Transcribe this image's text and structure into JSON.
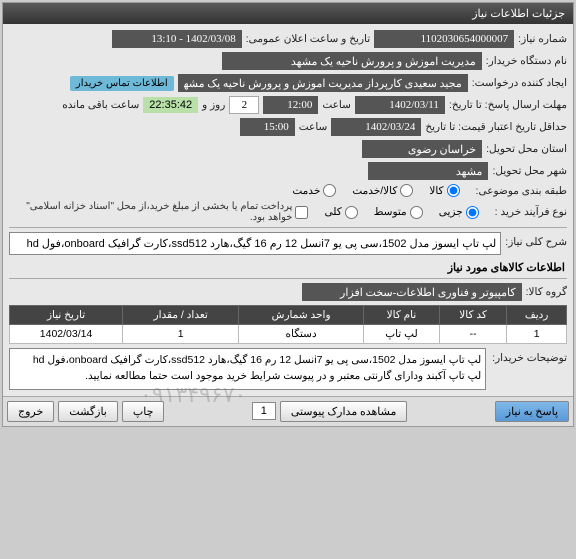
{
  "header": {
    "title": "جزئیات اطلاعات نیاز"
  },
  "form": {
    "need_number_label": "شماره نیاز:",
    "need_number": "1102030654000007",
    "announce_label": "تاریخ و ساعت اعلان عمومی:",
    "announce_value": "1402/03/08 - 13:10",
    "buyer_org_label": "نام دستگاه خریدار:",
    "buyer_org": "مدیریت اموزش و پرورش ناحیه یک مشهد",
    "creator_label": "ایجاد کننده درخواست:",
    "creator": "مجید سعیدی کارپرداز مدیریت اموزش و پرورش ناحیه یک مشهد",
    "contact_link": "اطلاعات تماس خریدار",
    "deadline_label": "مهلت ارسال پاسخ: تا تاریخ:",
    "deadline_date": "1402/03/11",
    "time_label": "ساعت",
    "deadline_time": "12:00",
    "days": "2",
    "days_label": "روز و",
    "countdown": "22:35:42",
    "remaining_label": "ساعت باقی مانده",
    "validity_label": "حداقل تاریخ اعتبار قیمت: تا تاریخ",
    "validity_date": "1402/03/24",
    "validity_time": "15:00",
    "province_label": "استان محل تحویل:",
    "province": "خراسان رضوی",
    "city_label": "شهر محل تحویل:",
    "city": "مشهد",
    "category_label": "طبقه بندی موضوعی:",
    "categories": [
      "کالا",
      "کالا/خدمت",
      "خدمت"
    ],
    "purchase_type_label": "نوع فرآیند خرید :",
    "purchase_types": [
      "جزیی",
      "متوسط",
      "کلی"
    ],
    "purchase_note": "پرداخت تمام یا بخشی از مبلغ خرید،از محل \"اسناد خزانه اسلامی\" خواهد بود.",
    "need_desc_label": "شرح کلی نیاز:",
    "need_desc": "لپ تاپ ایسوز مدل 1502،سی پی یو i7نسل 12 رم 16 گیگ،هارد ssd512،کارت گرافیک onboard،فول hd",
    "goods_section_title": "اطلاعات کالاهای مورد نیاز",
    "goods_group_label": "گروه کالا:",
    "goods_group": "کامپیوتر و فناوری اطلاعات-سخت افزار",
    "table": {
      "headers": [
        "ردیف",
        "کد کالا",
        "نام کالا",
        "واحد شمارش",
        "تعداد / مقدار",
        "تاریخ نیاز"
      ],
      "rows": [
        {
          "idx": "1",
          "code": "--",
          "name": "لپ تاپ",
          "unit": "دستگاه",
          "qty": "1",
          "date": "1402/03/14"
        }
      ]
    },
    "buyer_notes_label": "توضیحات خریدار:",
    "buyer_notes_line1": "لپ تاپ ایسوز مدل 1502،سی پی یو i7نسل 12 رم 16 گیگ،هارد ssd512،کارت گرافیک onboard،فول hd",
    "buyer_notes_line2": "لپ تاپ آکبند ودارای گارنتی معتبر و در پیوست شرایط خرید موجود است حتما مطالعه نمایید."
  },
  "footer": {
    "respond_btn": "پاسخ به نیاز",
    "attach_btn": "مشاهده مدارک پیوستی",
    "page": "1",
    "print_btn": "چاپ",
    "back_btn": "بازگشت",
    "exit_btn": "خروج"
  },
  "watermark": "۰۹۱۳۴۹۶۷۰"
}
